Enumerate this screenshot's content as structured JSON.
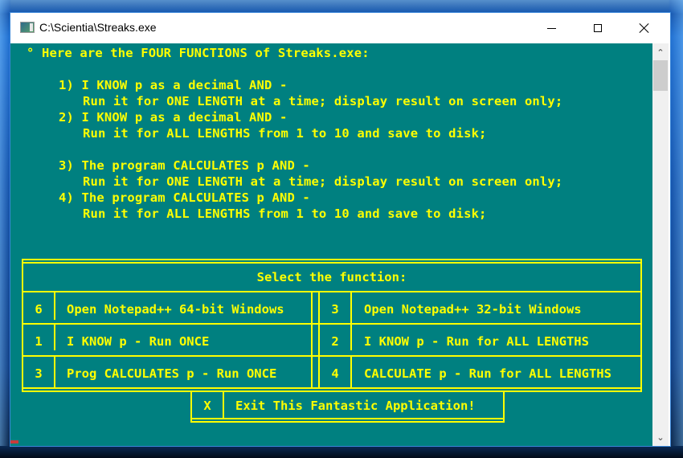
{
  "window": {
    "title": "C:\\Scientia\\Streaks.exe",
    "controls": {
      "minimize": "minimize",
      "maximize": "maximize",
      "close": "close"
    }
  },
  "console": {
    "colors": {
      "background": "#008080",
      "text": "#ffff00"
    },
    "intro": "° Here are the FOUR FUNCTIONS of Streaks.exe:",
    "functions": [
      {
        "line1": "1) I KNOW p as a decimal AND -",
        "line2": "Run it for ONE LENGTH at a time; display result on screen only;"
      },
      {
        "line1": "2) I KNOW p as a decimal AND -",
        "line2": "Run it for ALL LENGTHS from 1 to 10 and save to disk;"
      },
      {
        "line1": "3) The program CALCULATES p AND -",
        "line2": "Run it for ONE LENGTH at a time; display result on screen only;"
      },
      {
        "line1": "4) The program CALCULATES p AND -",
        "line2": "Run it for ALL LENGTHS from 1 to 10 and save to disk;"
      }
    ]
  },
  "menu": {
    "title": "Select the function:",
    "rows": [
      {
        "left": {
          "key": "6",
          "label": "Open Notepad++ 64-bit Windows"
        },
        "right": {
          "key": "3",
          "label": "Open Notepad++ 32-bit Windows"
        }
      },
      {
        "left": {
          "key": "1",
          "label": "I KNOW p - Run ONCE"
        },
        "right": {
          "key": "2",
          "label": "I KNOW p - Run for ALL LENGTHS"
        }
      },
      {
        "left": {
          "key": "3",
          "label": "Prog CALCULATES p - Run ONCE"
        },
        "right": {
          "key": "4",
          "label": "CALCULATE p - Run for ALL LENGTHS"
        }
      }
    ],
    "exit": {
      "key": "X",
      "label": "Exit This Fantastic Application!"
    }
  },
  "scrollbar": {
    "up": "^",
    "down": "v"
  }
}
